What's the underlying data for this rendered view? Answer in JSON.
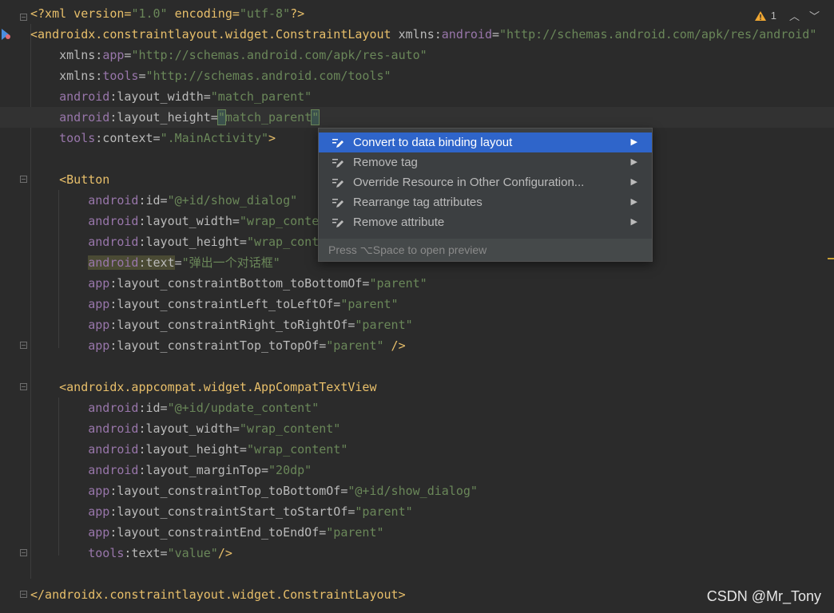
{
  "editor": {
    "lines": [
      {
        "tokens": [
          {
            "c": "tag",
            "t": "<?xml version="
          },
          {
            "c": "val",
            "t": "\"1.0\""
          },
          {
            "c": "tag",
            "t": " encoding="
          },
          {
            "c": "val",
            "t": "\"utf-8\""
          },
          {
            "c": "tag",
            "t": "?>"
          }
        ]
      },
      {
        "tokens": [
          {
            "c": "tag",
            "t": "<androidx.constraintlayout.widget.ConstraintLayout "
          },
          {
            "c": "attr",
            "t": "xmlns:"
          },
          {
            "c": "ns",
            "t": "android"
          },
          {
            "c": "attr",
            "t": "="
          },
          {
            "c": "val",
            "t": "\"http://schemas.android.com/apk/res/android\""
          }
        ]
      },
      {
        "tokens": [
          {
            "c": "plain",
            "t": "    "
          },
          {
            "c": "attr",
            "t": "xmlns:"
          },
          {
            "c": "ns",
            "t": "app"
          },
          {
            "c": "attr",
            "t": "="
          },
          {
            "c": "val",
            "t": "\"http://schemas.android.com/apk/res-auto\""
          }
        ]
      },
      {
        "tokens": [
          {
            "c": "plain",
            "t": "    "
          },
          {
            "c": "attr",
            "t": "xmlns:"
          },
          {
            "c": "ns",
            "t": "tools"
          },
          {
            "c": "attr",
            "t": "="
          },
          {
            "c": "val",
            "t": "\"http://schemas.android.com/tools\""
          }
        ]
      },
      {
        "tokens": [
          {
            "c": "plain",
            "t": "    "
          },
          {
            "c": "ns",
            "t": "android"
          },
          {
            "c": "attr",
            "t": ":layout_width="
          },
          {
            "c": "val",
            "t": "\"match_parent\""
          }
        ]
      },
      {
        "current": true,
        "tokens": [
          {
            "c": "plain",
            "t": "    "
          },
          {
            "c": "ns",
            "t": "android"
          },
          {
            "c": "attr",
            "t": ":layout_height="
          },
          {
            "c": "val caret-hl",
            "t": "\""
          },
          {
            "c": "val",
            "t": "match_parent"
          },
          {
            "c": "val caret-hl",
            "t": "\""
          }
        ]
      },
      {
        "tokens": [
          {
            "c": "plain",
            "t": "    "
          },
          {
            "c": "ns",
            "t": "tools"
          },
          {
            "c": "attr",
            "t": ":context="
          },
          {
            "c": "val",
            "t": "\".MainActivity\""
          },
          {
            "c": "tag",
            "t": ">"
          }
        ]
      },
      {
        "tokens": []
      },
      {
        "tokens": [
          {
            "c": "plain",
            "t": "    "
          },
          {
            "c": "tag",
            "t": "<Button"
          }
        ]
      },
      {
        "tokens": [
          {
            "c": "plain",
            "t": "        "
          },
          {
            "c": "ns",
            "t": "android"
          },
          {
            "c": "attr",
            "t": ":id="
          },
          {
            "c": "val",
            "t": "\"@+id/show_dialog\""
          }
        ]
      },
      {
        "tokens": [
          {
            "c": "plain",
            "t": "        "
          },
          {
            "c": "ns",
            "t": "android"
          },
          {
            "c": "attr",
            "t": ":layout_width="
          },
          {
            "c": "val",
            "t": "\"wrap_content\""
          }
        ]
      },
      {
        "tokens": [
          {
            "c": "plain",
            "t": "        "
          },
          {
            "c": "ns",
            "t": "android"
          },
          {
            "c": "attr",
            "t": ":layout_height="
          },
          {
            "c": "val",
            "t": "\"wrap_content\""
          }
        ]
      },
      {
        "tokens": [
          {
            "c": "plain",
            "t": "        "
          },
          {
            "c": "ns hl",
            "t": "android"
          },
          {
            "c": "attr hl",
            "t": ":text"
          },
          {
            "c": "attr",
            "t": "="
          },
          {
            "c": "val",
            "t": "\"弹出一个对话框\""
          }
        ]
      },
      {
        "tokens": [
          {
            "c": "plain",
            "t": "        "
          },
          {
            "c": "ns",
            "t": "app"
          },
          {
            "c": "attr",
            "t": ":layout_constraintBottom_toBottomOf="
          },
          {
            "c": "val",
            "t": "\"parent\""
          }
        ]
      },
      {
        "tokens": [
          {
            "c": "plain",
            "t": "        "
          },
          {
            "c": "ns",
            "t": "app"
          },
          {
            "c": "attr",
            "t": ":layout_constraintLeft_toLeftOf="
          },
          {
            "c": "val",
            "t": "\"parent\""
          }
        ]
      },
      {
        "tokens": [
          {
            "c": "plain",
            "t": "        "
          },
          {
            "c": "ns",
            "t": "app"
          },
          {
            "c": "attr",
            "t": ":layout_constraintRight_toRightOf="
          },
          {
            "c": "val",
            "t": "\"parent\""
          }
        ]
      },
      {
        "tokens": [
          {
            "c": "plain",
            "t": "        "
          },
          {
            "c": "ns",
            "t": "app"
          },
          {
            "c": "attr",
            "t": ":layout_constraintTop_toTopOf="
          },
          {
            "c": "val",
            "t": "\"parent\""
          },
          {
            "c": "tag",
            "t": " />"
          }
        ]
      },
      {
        "tokens": []
      },
      {
        "tokens": [
          {
            "c": "plain",
            "t": "    "
          },
          {
            "c": "tag",
            "t": "<androidx.appcompat.widget.AppCompatTextView"
          }
        ]
      },
      {
        "tokens": [
          {
            "c": "plain",
            "t": "        "
          },
          {
            "c": "ns",
            "t": "android"
          },
          {
            "c": "attr",
            "t": ":id="
          },
          {
            "c": "val",
            "t": "\"@+id/update_content\""
          }
        ]
      },
      {
        "tokens": [
          {
            "c": "plain",
            "t": "        "
          },
          {
            "c": "ns",
            "t": "android"
          },
          {
            "c": "attr",
            "t": ":layout_width="
          },
          {
            "c": "val",
            "t": "\"wrap_content\""
          }
        ]
      },
      {
        "tokens": [
          {
            "c": "plain",
            "t": "        "
          },
          {
            "c": "ns",
            "t": "android"
          },
          {
            "c": "attr",
            "t": ":layout_height="
          },
          {
            "c": "val",
            "t": "\"wrap_content\""
          }
        ]
      },
      {
        "tokens": [
          {
            "c": "plain",
            "t": "        "
          },
          {
            "c": "ns",
            "t": "android"
          },
          {
            "c": "attr",
            "t": ":layout_marginTop="
          },
          {
            "c": "val",
            "t": "\"20dp\""
          }
        ]
      },
      {
        "tokens": [
          {
            "c": "plain",
            "t": "        "
          },
          {
            "c": "ns",
            "t": "app"
          },
          {
            "c": "attr",
            "t": ":layout_constraintTop_toBottomOf="
          },
          {
            "c": "val",
            "t": "\"@+id/show_dialog\""
          }
        ]
      },
      {
        "tokens": [
          {
            "c": "plain",
            "t": "        "
          },
          {
            "c": "ns",
            "t": "app"
          },
          {
            "c": "attr",
            "t": ":layout_constraintStart_toStartOf="
          },
          {
            "c": "val",
            "t": "\"parent\""
          }
        ]
      },
      {
        "tokens": [
          {
            "c": "plain",
            "t": "        "
          },
          {
            "c": "ns",
            "t": "app"
          },
          {
            "c": "attr",
            "t": ":layout_constraintEnd_toEndOf="
          },
          {
            "c": "val",
            "t": "\"parent\""
          }
        ]
      },
      {
        "tokens": [
          {
            "c": "plain",
            "t": "        "
          },
          {
            "c": "ns",
            "t": "tools"
          },
          {
            "c": "attr",
            "t": ":text="
          },
          {
            "c": "val",
            "t": "\"value\""
          },
          {
            "c": "tag",
            "t": "/>"
          }
        ]
      },
      {
        "tokens": []
      },
      {
        "tokens": [
          {
            "c": "tag",
            "t": "</androidx.constraintlayout.widget.ConstraintLayout>"
          }
        ]
      }
    ]
  },
  "inspections": {
    "warning_count": "1"
  },
  "popup": {
    "items": [
      {
        "label": "Convert to data binding layout",
        "selected": true
      },
      {
        "label": "Remove tag"
      },
      {
        "label": "Override Resource in Other Configuration..."
      },
      {
        "label": "Rearrange tag attributes"
      },
      {
        "label": "Remove attribute"
      }
    ],
    "footer": "Press ⌥Space to open preview"
  },
  "watermark": "CSDN @Mr_Tony",
  "colors": {
    "accent": "#2f65ca",
    "tag": "#e8bf6a",
    "namespace": "#9876aa",
    "string": "#6a8759"
  }
}
